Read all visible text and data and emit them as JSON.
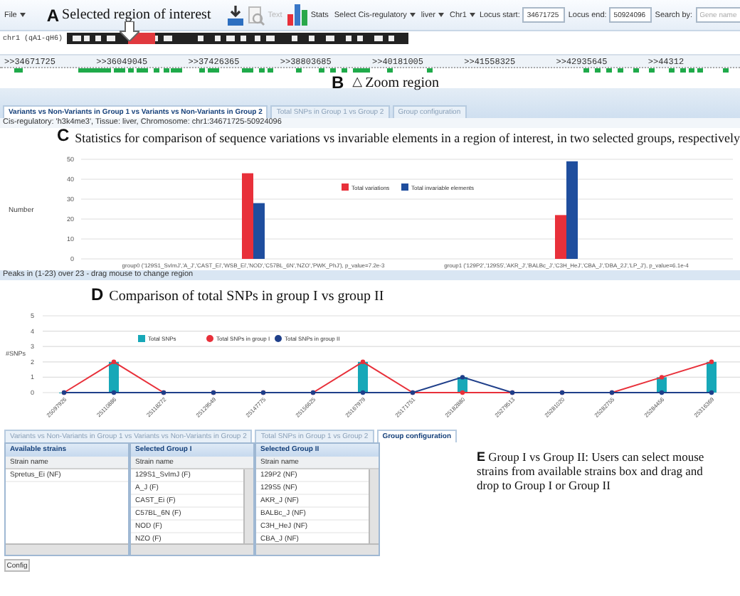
{
  "toolbar": {
    "file_menu": "File",
    "annotation": {
      "letter": "A",
      "caption": "Selected region of interest"
    },
    "tool_buttons": [
      {
        "kind": "text",
        "label": "Text",
        "disabled": true
      },
      {
        "kind": "stats",
        "label": "Stats",
        "disabled": false
      }
    ],
    "dropdowns": [
      "Select Cis-regulatory",
      "liver",
      "Chr1"
    ],
    "fields": [
      {
        "label": "Locus start:",
        "value": "34671725"
      },
      {
        "label": "Locus end:",
        "value": "50924096"
      },
      {
        "label": "Search by:",
        "placeholder": "Gene name"
      }
    ]
  },
  "chromosome": {
    "label": "chr1 (qA1-qH6)"
  },
  "ruler": {
    "positions": [
      ">>34671725",
      ">>36049045",
      ">>37426365",
      ">>38803685",
      ">>40181005",
      ">>41558325",
      ">>42935645",
      ">>44312"
    ]
  },
  "zoom_annotation": {
    "letter": "B",
    "symbol": "△",
    "caption": "Zoom region"
  },
  "top_tabs": [
    {
      "label": "Variants vs Non-Variants in Group 1 vs Variants vs Non-Variants in Group 2",
      "selected": true
    },
    {
      "label": "Total SNPs in Group 1 vs Group 2",
      "selected": false
    },
    {
      "label": "Group configuration",
      "selected": false
    }
  ],
  "status": "Cis-regulatory: 'h3k4me3', Tissue: liver, Chromosome: chr1:34671725-50924096",
  "stats_panel": {
    "annotation": {
      "letter": "C",
      "caption": "Statistics for comparison of sequence variations vs invariable elements in a region of interest, in two selected groups, respectively"
    },
    "chart_data": {
      "type": "bar",
      "ylabel": "Number",
      "grid": true,
      "legend": "upper center",
      "categories": [
        "group0 ('129S1_SvImJ','A_J','CAST_Ei','WSB_Ei','NOD','C57BL_6N','NZO','PWK_PhJ'), p_value=7.2e-3",
        "group1 ('129P2','129S5','AKR_J','BALBc_J','C3H_HeJ','CBA_J','DBA_2J','LP_J'), p_value=6.1e-4"
      ],
      "series": [
        {
          "name": "Total variations",
          "color": "#e8303a",
          "values": [
            43,
            22
          ]
        },
        {
          "name": "Total invariable elements",
          "color": "#1f4e9e",
          "values": [
            28,
            49
          ]
        }
      ],
      "ylim": [
        0,
        50
      ],
      "yticks": [
        0,
        10,
        20,
        30,
        40,
        50
      ]
    }
  },
  "peaks_note": "Peaks in (1-23) over 23 - drag mouse to change region",
  "snp_panel": {
    "annotation": {
      "letter": "D",
      "caption": "Comparison of total SNPs in group I vs group II"
    },
    "chart_data": {
      "type": "line",
      "ylabel": "#SNPs",
      "grid": true,
      "legend": "upper left",
      "categories": [
        "25097926",
        "25110886",
        "25118272",
        "25129549",
        "25147775",
        "25156625",
        "25167979",
        "25171751",
        "25182880",
        "25279513",
        "25281020",
        "25282755",
        "25284456",
        "25316369"
      ],
      "series": [
        {
          "name": "Total SNPs in group I",
          "type": "line",
          "marker": "circle",
          "color": "#e8303a",
          "values": [
            0,
            2,
            0,
            0,
            0,
            0,
            2,
            0,
            0,
            0,
            0,
            0,
            1,
            2
          ]
        },
        {
          "name": "Total SNPs in group II",
          "type": "line",
          "marker": "circle",
          "color": "#1f3f8a",
          "values": [
            0,
            0,
            0,
            0,
            0,
            0,
            0,
            0,
            1,
            0,
            0,
            0,
            0,
            0
          ]
        },
        {
          "name": "Total SNPs",
          "type": "bar",
          "color": "#17a8b8",
          "values": [
            0,
            2,
            0,
            0,
            0,
            0,
            2,
            0,
            1,
            0,
            0,
            0,
            1,
            2
          ]
        }
      ],
      "ylim": [
        0,
        5
      ],
      "yticks": [
        0,
        1,
        2,
        3,
        4,
        5
      ]
    }
  },
  "bottom_tabs": [
    {
      "label": "Variants vs Non-Variants in Group 1 vs Variants vs Non-Variants in Group 2",
      "selected": false
    },
    {
      "label": "Total SNPs in Group 1 vs Group 2",
      "selected": false
    },
    {
      "label": "Group configuration",
      "selected": true
    }
  ],
  "strain_lists": [
    {
      "title": "Available strains",
      "column": "Strain name",
      "scroll": false,
      "rows": [
        "Spretus_Ei (NF)"
      ]
    },
    {
      "title": "Selected Group I",
      "column": "Strain name",
      "scroll": true,
      "rows": [
        "129S1_SvImJ (F)",
        "A_J (F)",
        "CAST_Ei (F)",
        "C57BL_6N (F)",
        "NOD (F)",
        "NZO (F)"
      ]
    },
    {
      "title": "Selected Group II",
      "column": "Strain name",
      "scroll": true,
      "rows": [
        "129P2 (NF)",
        "129S5 (NF)",
        "AKR_J (NF)",
        "BALBc_J (NF)",
        "C3H_HeJ (NF)",
        "CBA_J (NF)"
      ]
    }
  ],
  "group_annotation": {
    "letter": "E",
    "caption": "Group I vs Group II: Users can select mouse strains from available strains box and drag and drop to Group I or Group II"
  },
  "config_button": "Config"
}
